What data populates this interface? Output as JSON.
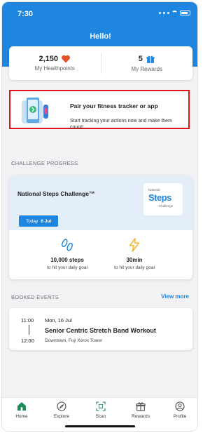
{
  "status_bar": {
    "time": "7:30"
  },
  "header": {
    "title": "Hello!"
  },
  "summary": {
    "healthpoints_value": "2,150",
    "healthpoints_label": "My Healthpoints",
    "rewards_value": "5",
    "rewards_label": "My Rewards"
  },
  "pair_tracker": {
    "title": "Pair your fitness tracker or app",
    "description": "Start tracking your actions now and make them count!"
  },
  "challenge_section": {
    "label": "CHALLENGE PROGRESS",
    "challenge_name": "National Steps Challenge™",
    "logo_line1": "National",
    "logo_line2": "Steps",
    "logo_line3": "Challenge",
    "date_prefix": "Today",
    "date_value": "6 Jul",
    "steps_value": "10,000 steps",
    "steps_sub": "to hit your daily goal",
    "minutes_value": "30min",
    "minutes_sub": "to hit your daily goal"
  },
  "events_section": {
    "label": "BOOKED EVENTS",
    "view_more": "View more",
    "event": {
      "start_time": "11:00",
      "date": "Mon, 16 Jul",
      "title": "Senior Centric Stretch Band Workout",
      "end_time": "12:00",
      "location": "Downtown, Fuji Xerox Tower"
    }
  },
  "tabs": [
    {
      "label": "Home",
      "icon": "home-icon",
      "active": true
    },
    {
      "label": "Explore",
      "icon": "compass-icon"
    },
    {
      "label": "Scan",
      "icon": "scan-icon"
    },
    {
      "label": "Rewards",
      "icon": "gift-icon"
    },
    {
      "label": "Profile",
      "icon": "profile-icon"
    }
  ],
  "colors": {
    "primary_blue": "#1f86e0",
    "highlight_red": "#e2141b",
    "heart_orange": "#e0532a",
    "active_tab_green": "#1e8a5a"
  }
}
